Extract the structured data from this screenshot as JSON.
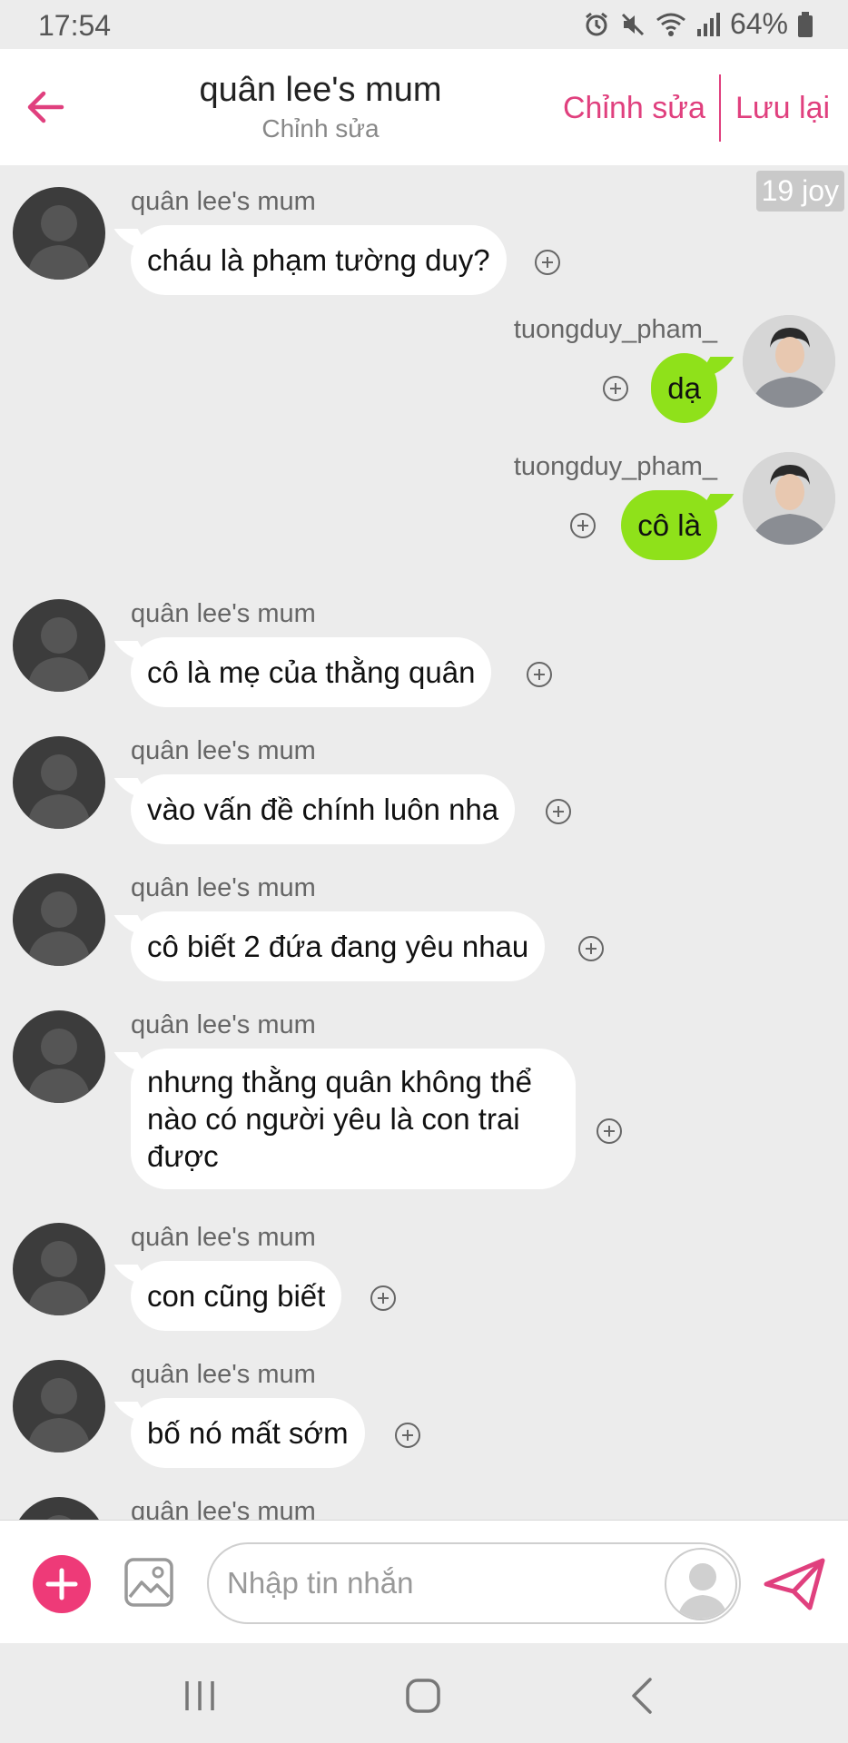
{
  "status_bar": {
    "time": "17:54",
    "battery": "64%"
  },
  "header": {
    "title": "quân lee's mum",
    "subtitle": "Chỉnh sửa",
    "edit_label": "Chỉnh sửa",
    "save_label": "Lưu lại"
  },
  "joy_badge": "19 joy",
  "messages": [
    {
      "direction": "in",
      "sender": "quân lee's mum",
      "text": "cháu là phạm tường duy?"
    },
    {
      "direction": "out",
      "sender": "tuongduy_pham_",
      "text": "dạ"
    },
    {
      "direction": "out",
      "sender": "tuongduy_pham_",
      "text": "cô là"
    },
    {
      "direction": "in",
      "sender": "quân lee's mum",
      "text": "cô là mẹ của thằng quân"
    },
    {
      "direction": "in",
      "sender": "quân lee's mum",
      "text": "vào vấn đề chính luôn nha"
    },
    {
      "direction": "in",
      "sender": "quân lee's mum",
      "text": "cô biết 2 đứa đang yêu nhau"
    },
    {
      "direction": "in",
      "sender": "quân lee's mum",
      "text": "nhưng thằng quân không thể\nnào có người yêu là con trai\nđược"
    },
    {
      "direction": "in",
      "sender": "quân lee's mum",
      "text": "con cũng biết"
    },
    {
      "direction": "in",
      "sender": "quân lee's mum",
      "text": "bố nó mất sớm"
    },
    {
      "direction": "in",
      "sender": "quân lee's mum",
      "text": ""
    }
  ],
  "input": {
    "placeholder": "Nhập tin nhắn"
  },
  "colors": {
    "accent": "#e0407e",
    "outgoing_bubble": "#8fe11a",
    "incoming_bubble": "#ffffff",
    "background": "#ececec"
  },
  "icons": {
    "back": "arrow-left-icon",
    "react": "plus-circle-icon",
    "add": "plus-icon",
    "image": "image-icon",
    "send": "send-icon"
  }
}
